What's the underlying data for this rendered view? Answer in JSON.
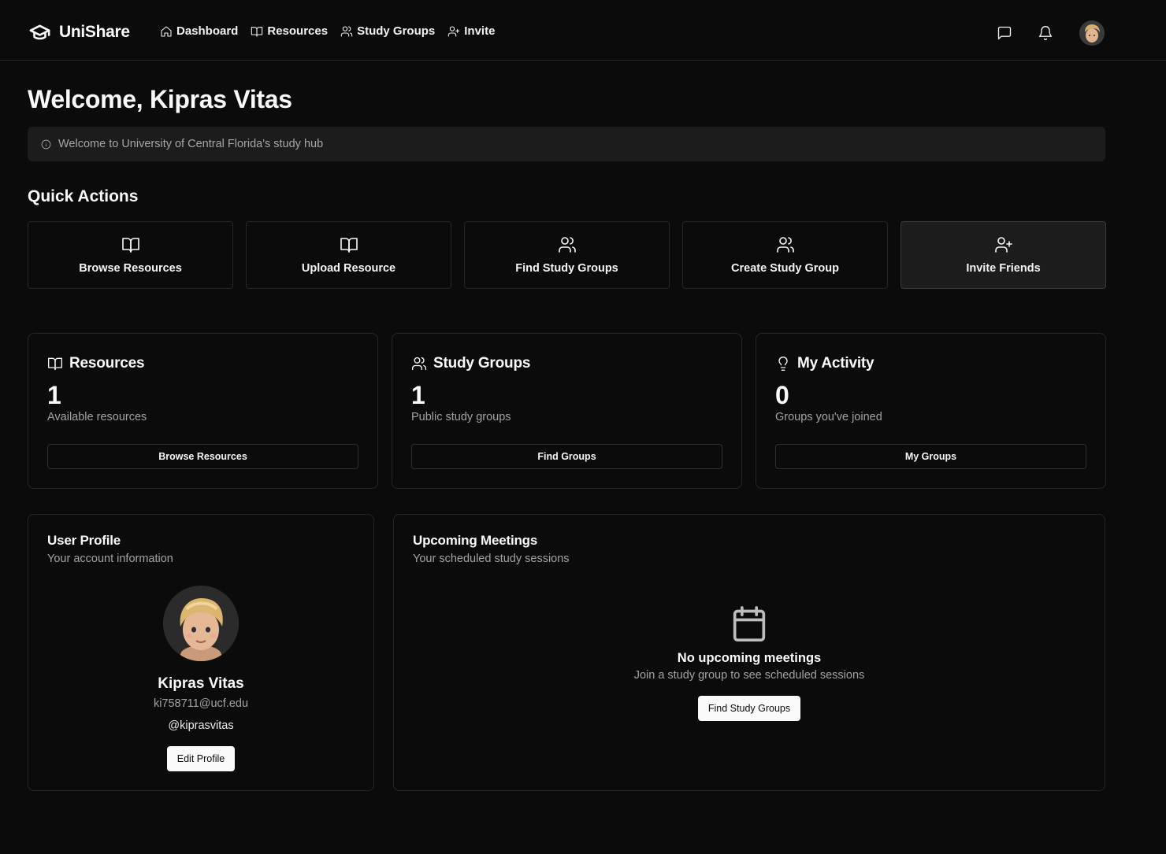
{
  "nav": {
    "brand": "UniShare",
    "links": [
      {
        "label": "Dashboard",
        "icon": "home-icon"
      },
      {
        "label": "Resources",
        "icon": "book-open-icon"
      },
      {
        "label": "Study Groups",
        "icon": "users-icon"
      },
      {
        "label": "Invite",
        "icon": "user-plus-icon"
      }
    ],
    "right_icons": [
      "message-square-icon",
      "bell-icon",
      "avatar"
    ]
  },
  "welcome": {
    "title": "Welcome, Kipras Vitas",
    "alert": "Welcome to University of Central Florida's study hub"
  },
  "quick_actions": {
    "title": "Quick Actions",
    "items": [
      {
        "label": "Browse Resources",
        "icon": "book-open-icon"
      },
      {
        "label": "Upload Resource",
        "icon": "book-open-icon"
      },
      {
        "label": "Find Study Groups",
        "icon": "users-icon"
      },
      {
        "label": "Create Study Group",
        "icon": "users-icon"
      },
      {
        "label": "Invite Friends",
        "icon": "user-plus-icon"
      }
    ]
  },
  "stats": [
    {
      "title": "Resources",
      "icon": "book-open-icon",
      "value": "1",
      "sub": "Available resources",
      "button": "Browse Resources"
    },
    {
      "title": "Study Groups",
      "icon": "users-icon",
      "value": "1",
      "sub": "Public study groups",
      "button": "Find Groups"
    },
    {
      "title": "My Activity",
      "icon": "lightbulb-icon",
      "value": "0",
      "sub": "Groups you've joined",
      "button": "My Groups"
    }
  ],
  "profile": {
    "title": "User Profile",
    "subtitle": "Your account information",
    "name": "Kipras Vitas",
    "email": "ki758711@ucf.edu",
    "handle": "@kiprasvitas",
    "edit_button": "Edit Profile"
  },
  "meetings": {
    "title": "Upcoming Meetings",
    "subtitle": "Your scheduled study sessions",
    "empty_title": "No upcoming meetings",
    "empty_sub": "Join a study group to see scheduled sessions",
    "button": "Find Study Groups"
  },
  "colors": {
    "background": "#0b0b0b",
    "card_border": "#262626",
    "alert_bg": "#1c1c1c",
    "muted_text": "#a3a3a3",
    "button_light": "#fafafa"
  }
}
